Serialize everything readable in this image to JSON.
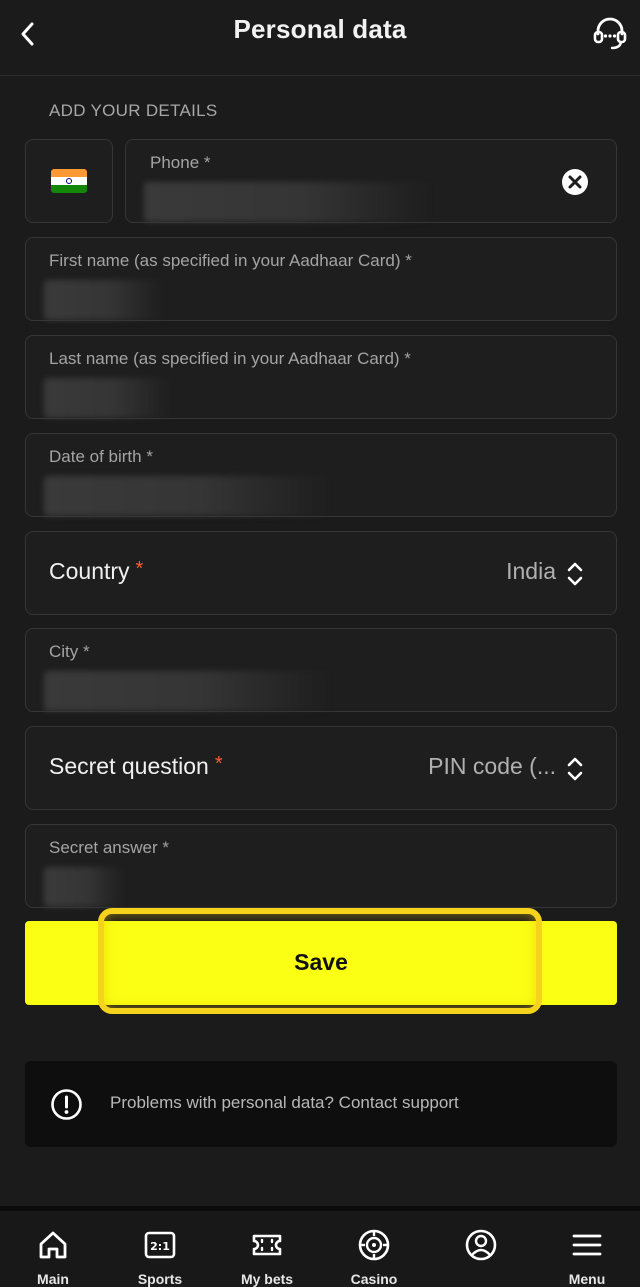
{
  "header": {
    "title": "Personal data",
    "back_icon": "chevron-left-icon",
    "support_icon": "headset-icon"
  },
  "form": {
    "section_label": "ADD YOUR DETAILS",
    "phone": {
      "label": "Phone *",
      "country_flag": "india-flag-icon"
    },
    "first_name": {
      "label": "First name (as specified in your Aadhaar Card) *"
    },
    "last_name": {
      "label": "Last name (as specified in your Aadhaar Card) *"
    },
    "dob": {
      "label": "Date of birth *"
    },
    "country": {
      "label": "Country",
      "required_mark": "*",
      "value": "India"
    },
    "city": {
      "label": "City *"
    },
    "secret_question": {
      "label": "Secret question",
      "required_mark": "*",
      "value": "PIN code (..."
    },
    "secret_answer": {
      "label": "Secret answer *"
    }
  },
  "actions": {
    "save_label": "Save"
  },
  "info": {
    "text": "Problems with personal data? Contact support"
  },
  "nav": {
    "items": [
      {
        "label": "Main",
        "icon": "home-icon"
      },
      {
        "label": "Sports",
        "icon": "sports-odds-icon"
      },
      {
        "label": "My bets",
        "icon": "ticket-icon"
      },
      {
        "label": "Casino",
        "icon": "casino-chip-icon"
      },
      {
        "label": "",
        "icon": "profile-icon"
      },
      {
        "label": "Menu",
        "icon": "menu-icon"
      }
    ]
  },
  "colors": {
    "background": "#1b1b1b",
    "accent": "#fbff14",
    "required": "#ff5a3c",
    "highlight": "#f5d21c"
  }
}
